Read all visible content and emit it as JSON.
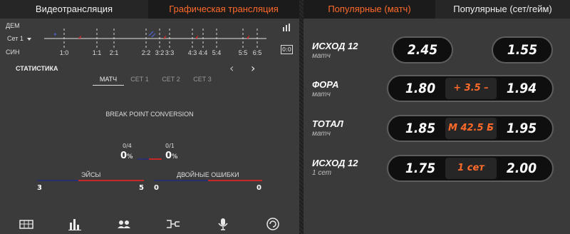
{
  "left_tabs": {
    "video": "Видеотрансляция",
    "graphic": "Графическая трансляция"
  },
  "right_tabs": {
    "popular_match": "Популярные (матч)",
    "popular_set": "Популярные (сет/гейм)"
  },
  "timeline": {
    "team_top": "ДЕМ",
    "team_bottom": "СИН",
    "set_selector": "Сет 1",
    "scores": [
      "1:0",
      "1:1",
      "2:1",
      "2:2",
      "3:2",
      "3:3",
      "4:3",
      "4:4",
      "5:4",
      "5:5",
      "6:5"
    ],
    "side_labels": {
      "bars": "bar-chart-icon",
      "score": "0:0"
    }
  },
  "stats": {
    "title": "СТАТИСТИКА",
    "subtabs": [
      "МАТЧ",
      "СЕТ 1",
      "СЕТ 2",
      "СЕТ 3"
    ],
    "break_points": {
      "title": "BREAK POINT CONVERSION",
      "left_frac": "0/4",
      "left_pct": "0",
      "pct_sign": "%",
      "right_frac": "0/1",
      "right_pct": "0"
    },
    "aces": {
      "label": "ЭЙСЫ",
      "left": "3",
      "right": "5"
    },
    "double_faults": {
      "label": "ДВОЙНЫЕ ОШИБКИ",
      "left": "0",
      "right": "0"
    }
  },
  "markets": [
    {
      "name": "ИСХОД 12",
      "sub": "матч",
      "odd1": "2.45",
      "mid": "",
      "odd2": "1.55"
    },
    {
      "name": "ФОРА",
      "sub": "матч",
      "odd1": "1.80",
      "mid": "+ 3.5 –",
      "odd2": "1.94"
    },
    {
      "name": "ТОТАЛ",
      "sub": "матч",
      "odd1": "1.85",
      "mid": "М 42.5 Б",
      "odd2": "1.95"
    },
    {
      "name": "ИСХОД 12",
      "sub": "1 сет",
      "odd1": "1.75",
      "mid": "1 сет",
      "odd2": "2.00"
    }
  ],
  "colors": {
    "accent": "#ff6a2a",
    "home": "#2b2f6e",
    "away": "#c62828"
  },
  "icons": [
    "scoreboard-icon",
    "stats-bars-icon",
    "lineups-icon",
    "bracket-icon",
    "microphone-icon",
    "refresh-icon"
  ]
}
